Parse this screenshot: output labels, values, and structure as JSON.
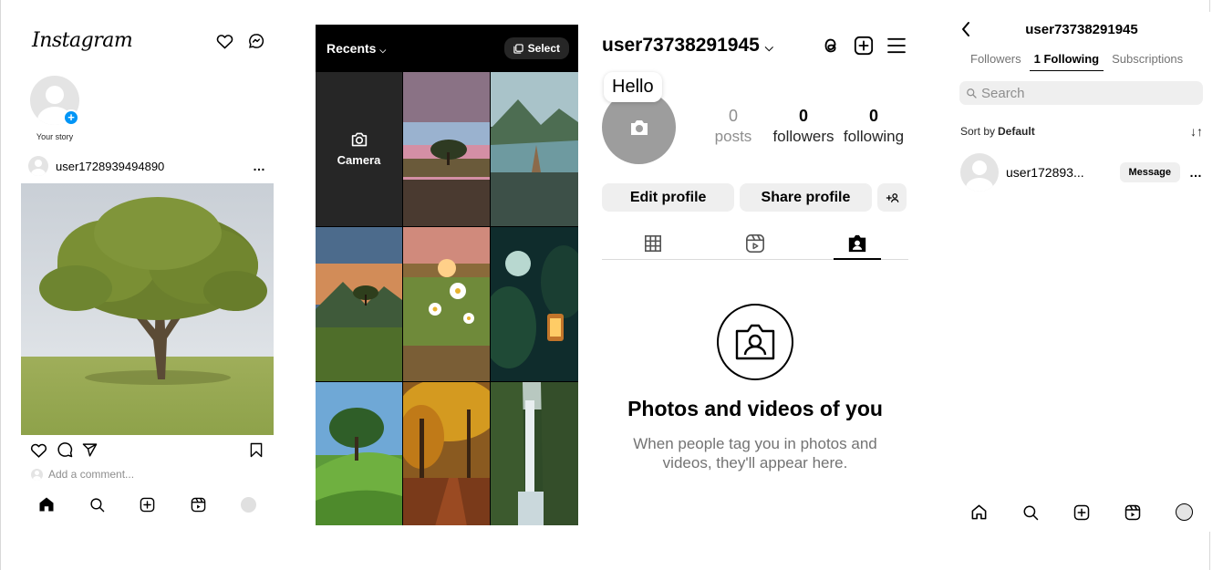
{
  "feed": {
    "logo": "Instagram",
    "story_label": "Your story",
    "story_plus": "+",
    "post_username": "user1728939494890",
    "post_more": "…",
    "comment_placeholder": "Add a comment...",
    "icons": [
      "heart-icon",
      "messenger-icon",
      "like-icon",
      "comment-icon",
      "share-icon",
      "bookmark-icon",
      "home-icon",
      "search-icon",
      "create-icon",
      "reels-icon",
      "profile-icon"
    ]
  },
  "gallery": {
    "title": "Recents",
    "select_label": "Select",
    "camera_label": "Camera",
    "thumbnails": [
      "purple sunset tree field",
      "mountain lake dock",
      "lone tree hills sunset",
      "daisy field sunset",
      "night forest lantern",
      "green hill tree",
      "autumn forest path",
      "waterfall cliff"
    ]
  },
  "profile": {
    "username": "user73738291945",
    "note_bubble": "Hello",
    "stats": [
      {
        "value": "0",
        "label": "posts"
      },
      {
        "value": "0",
        "label": "followers"
      },
      {
        "value": "0",
        "label": "following"
      }
    ],
    "edit_profile": "Edit profile",
    "share_profile": "Share profile",
    "discover_label": "+ ☃",
    "empty_title": "Photos and videos of you",
    "empty_desc": "When people tag you in photos and videos, they'll appear here."
  },
  "following_page": {
    "title": "user73738291945",
    "tabs": [
      "Followers",
      "1 Following",
      "Subscriptions"
    ],
    "search_placeholder": "Search",
    "sort_label": "Sort by",
    "sort_value": "Default",
    "sort_icon": "↓↑",
    "users": [
      {
        "name": "user172893...",
        "action": "Message",
        "more": "…"
      }
    ]
  },
  "colors": {
    "accent_blue": "#0095f6",
    "button_grey": "#efefef",
    "text_secondary": "#737373"
  }
}
